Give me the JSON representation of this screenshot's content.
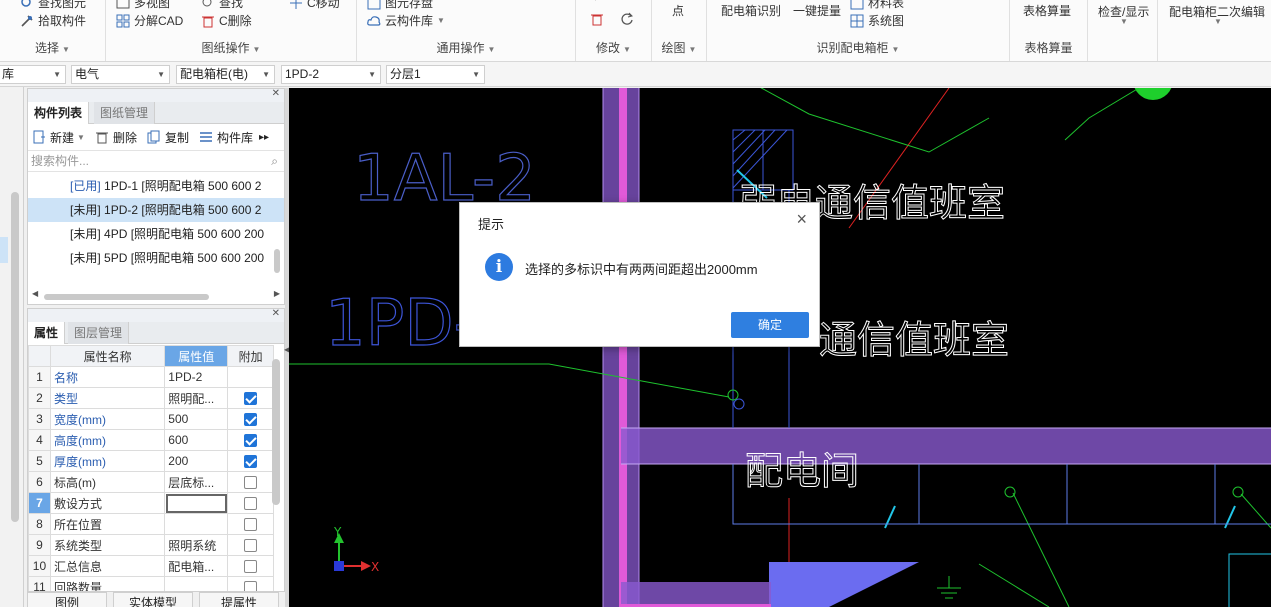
{
  "ribbon": {
    "groups": [
      {
        "name": "选择",
        "items": [
          {
            "label": "查找图元",
            "icon": "find-icon"
          },
          {
            "label": "拾取构件",
            "icon": "pick-icon"
          }
        ]
      },
      {
        "name": "图纸操作",
        "items": [
          {
            "label": "多视图",
            "icon": "multiview-icon"
          },
          {
            "label": "分解CAD",
            "icon": "explode-icon"
          },
          {
            "label": "查找",
            "icon": "search-icon"
          },
          {
            "label": "C删除",
            "icon": "delete-icon"
          },
          {
            "label": "C移动",
            "icon": "move-icon"
          }
        ]
      },
      {
        "name": "通用操作",
        "items": [
          {
            "label": "图元存盘",
            "icon": "save-icon"
          },
          {
            "label": "云构件库",
            "icon": "cloud-icon"
          }
        ]
      },
      {
        "name": "修改",
        "items": [
          {
            "label": "",
            "icon": "trash-icon"
          },
          {
            "label": "",
            "icon": "rotate-icon"
          }
        ]
      },
      {
        "name": "绘图",
        "items": [
          {
            "label": "点",
            "icon": ""
          }
        ]
      },
      {
        "name": "识别配电箱柜",
        "items": [
          {
            "label": "配电箱识别",
            "icon": ""
          },
          {
            "label": "一键提量",
            "icon": ""
          },
          {
            "label": "材料表",
            "icon": "table-icon"
          },
          {
            "label": "系统图",
            "icon": "diagram-icon"
          }
        ]
      },
      {
        "name": "表格算量",
        "items": [
          {
            "label": "表格算量",
            "icon": ""
          }
        ]
      },
      {
        "name": "",
        "items": [
          {
            "label": "检查/显示",
            "icon": ""
          }
        ]
      },
      {
        "name": "",
        "items": [
          {
            "label": "配电箱柜二次编辑",
            "icon": ""
          }
        ]
      }
    ]
  },
  "dropdowns": [
    {
      "value": "库"
    },
    {
      "value": "电气"
    },
    {
      "value": "配电箱柜(电)"
    },
    {
      "value": "1PD-2"
    },
    {
      "value": "分层1"
    }
  ],
  "component_panel": {
    "tabs": [
      "构件列表",
      "图纸管理"
    ],
    "toolbar": [
      "新建",
      "删除",
      "复制",
      "构件库"
    ],
    "search_placeholder": "搜索构件...",
    "items": [
      {
        "tag": "[已用]",
        "text": "1PD-1 [照明配电箱 500 600 2",
        "selected": false
      },
      {
        "tag": "[未用]",
        "text": "1PD-2 [照明配电箱 500 600 2",
        "selected": true
      },
      {
        "tag": "[未用]",
        "text": "4PD [照明配电箱 500 600 200",
        "selected": false
      },
      {
        "tag": "[未用]",
        "text": "5PD [照明配电箱 500 600 200",
        "selected": false
      }
    ]
  },
  "property_panel": {
    "tabs": [
      "属性",
      "图层管理"
    ],
    "headers": [
      "属性名称",
      "属性值",
      "附加"
    ],
    "rows": [
      {
        "num": "1",
        "name": "名称",
        "value": "1PD-2",
        "blue": true,
        "checkbox": "none"
      },
      {
        "num": "2",
        "name": "类型",
        "value": "照明配...",
        "blue": true,
        "checkbox": "on"
      },
      {
        "num": "3",
        "name": "宽度(mm)",
        "value": "500",
        "blue": true,
        "checkbox": "on"
      },
      {
        "num": "4",
        "name": "高度(mm)",
        "value": "600",
        "blue": true,
        "checkbox": "on"
      },
      {
        "num": "5",
        "name": "厚度(mm)",
        "value": "200",
        "blue": true,
        "checkbox": "on"
      },
      {
        "num": "6",
        "name": "标高(m)",
        "value": "层底标...",
        "blue": false,
        "checkbox": "off"
      },
      {
        "num": "7",
        "name": "敷设方式",
        "value": "",
        "blue": false,
        "checkbox": "off",
        "current": true
      },
      {
        "num": "8",
        "name": "所在位置",
        "value": "",
        "blue": false,
        "checkbox": "off"
      },
      {
        "num": "9",
        "name": "系统类型",
        "value": "照明系统",
        "blue": false,
        "checkbox": "off"
      },
      {
        "num": "10",
        "name": "汇总信息",
        "value": "配电箱...",
        "blue": false,
        "checkbox": "off"
      },
      {
        "num": "11",
        "name": "回路数量",
        "value": "",
        "blue": false,
        "checkbox": "off"
      }
    ],
    "bottom_tabs": [
      "图例",
      "实体模型",
      "提属性"
    ]
  },
  "cad": {
    "texts": [
      {
        "text": "1AL-2",
        "color": "#4a5ec8"
      },
      {
        "text": "1PD-2",
        "color": "#3d55d8"
      },
      {
        "text": "弱电通信值班室",
        "color": "#ffffff"
      },
      {
        "text": "通信值班室",
        "color": "#ffffff"
      },
      {
        "text": "配电间",
        "color": "#ffffff"
      }
    ],
    "axis_labels": {
      "y": "Y",
      "x": "X"
    }
  },
  "dialog": {
    "title": "提示",
    "message": "选择的多标识中有两两间距超出2000mm",
    "ok_label": "确定",
    "accent": "#2f7fe0"
  }
}
